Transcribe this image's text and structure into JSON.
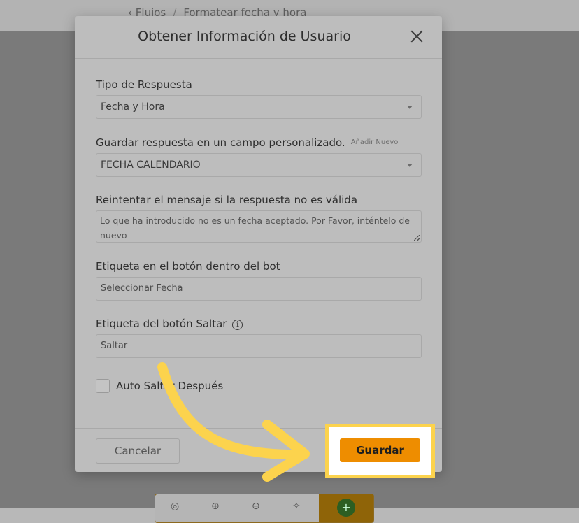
{
  "background": {
    "breadcrumb": {
      "parent": "Flujos",
      "separator": "/",
      "current": "Formatear fecha y hora"
    }
  },
  "modal": {
    "title": "Obtener Información de Usuario",
    "response_type": {
      "label": "Tipo de Respuesta",
      "value": "Fecha y Hora"
    },
    "save_field": {
      "label": "Guardar respuesta en un campo personalizado.",
      "add_new": "Añadir Nuevo",
      "value": "FECHA CALENDARIO"
    },
    "retry_message": {
      "label": "Reintentar el mensaje si la respuesta no es válida",
      "value": "Lo que ha introducido no es un fecha aceptado. Por Favor, inténtelo de nuevo"
    },
    "button_label": {
      "label": "Etiqueta en el botón dentro del bot",
      "value": "Seleccionar Fecha"
    },
    "skip_label": {
      "label": "Etiqueta del botón Saltar",
      "value": "Saltar"
    },
    "auto_skip": {
      "label": "Auto Saltar Después",
      "checked": false
    },
    "footer": {
      "cancel": "Cancelar",
      "save": "Guardar"
    }
  },
  "colors": {
    "accent": "#ee8d00",
    "highlight": "#fcd34d"
  },
  "icons": [
    "close-icon",
    "caret-down-icon",
    "info-icon",
    "resize-grip-icon",
    "arrow-annotation"
  ]
}
